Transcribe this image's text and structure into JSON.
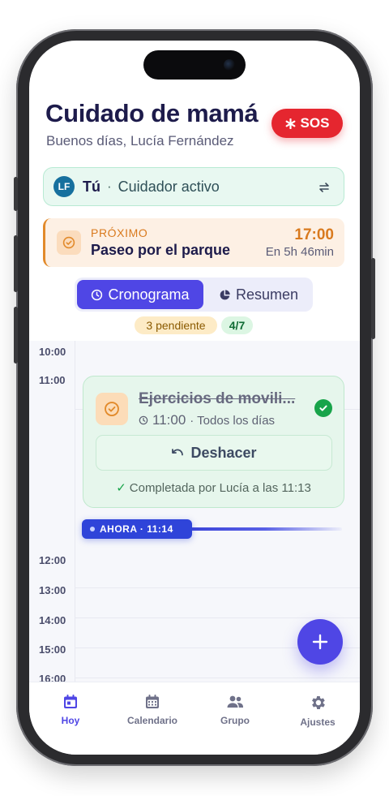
{
  "header": {
    "title": "Cuidado de mamá",
    "greeting": "Buenos días, Lucía Fernández",
    "sos_label": "SOS"
  },
  "caregiver": {
    "initials": "LF",
    "you_label": "Tú",
    "separator": "·",
    "role": "Cuidador activo"
  },
  "next_event": {
    "label": "PRÓXIMO",
    "name": "Paseo por el parque",
    "time": "17:00",
    "relative": "En 5h 46min"
  },
  "view_switch": {
    "options": [
      {
        "label": "Cronograma",
        "icon": "clock-icon",
        "active": true
      },
      {
        "label": "Resumen",
        "icon": "pie-chart-icon",
        "active": false
      }
    ]
  },
  "stats": {
    "pending": "3 pendiente",
    "progress": "4/7"
  },
  "timeline": {
    "hours": [
      "10:00",
      "11:00",
      "12:00",
      "13:00",
      "14:00",
      "15:00",
      "16:00"
    ],
    "task": {
      "title": "Ejercicios de movili...",
      "time": "11:00",
      "recurrence": "· Todos los días",
      "undo_label": "Deshacer",
      "completed_by": "Completada por Lucía a las 11:13",
      "status": "completed"
    },
    "now_label": "AHORA · 11:14"
  },
  "tabbar": {
    "items": [
      {
        "label": "Hoy",
        "icon": "calendar-today-icon",
        "active": true
      },
      {
        "label": "Calendario",
        "icon": "calendar-grid-icon",
        "active": false
      },
      {
        "label": "Grupo",
        "icon": "group-icon",
        "active": false
      },
      {
        "label": "Ajustes",
        "icon": "gear-icon",
        "active": false
      }
    ]
  },
  "colors": {
    "primary": "#4f46e5",
    "sos": "#e5262f",
    "accent_orange": "#d97a1e",
    "success": "#18a44a",
    "title": "#1d1b4b"
  }
}
